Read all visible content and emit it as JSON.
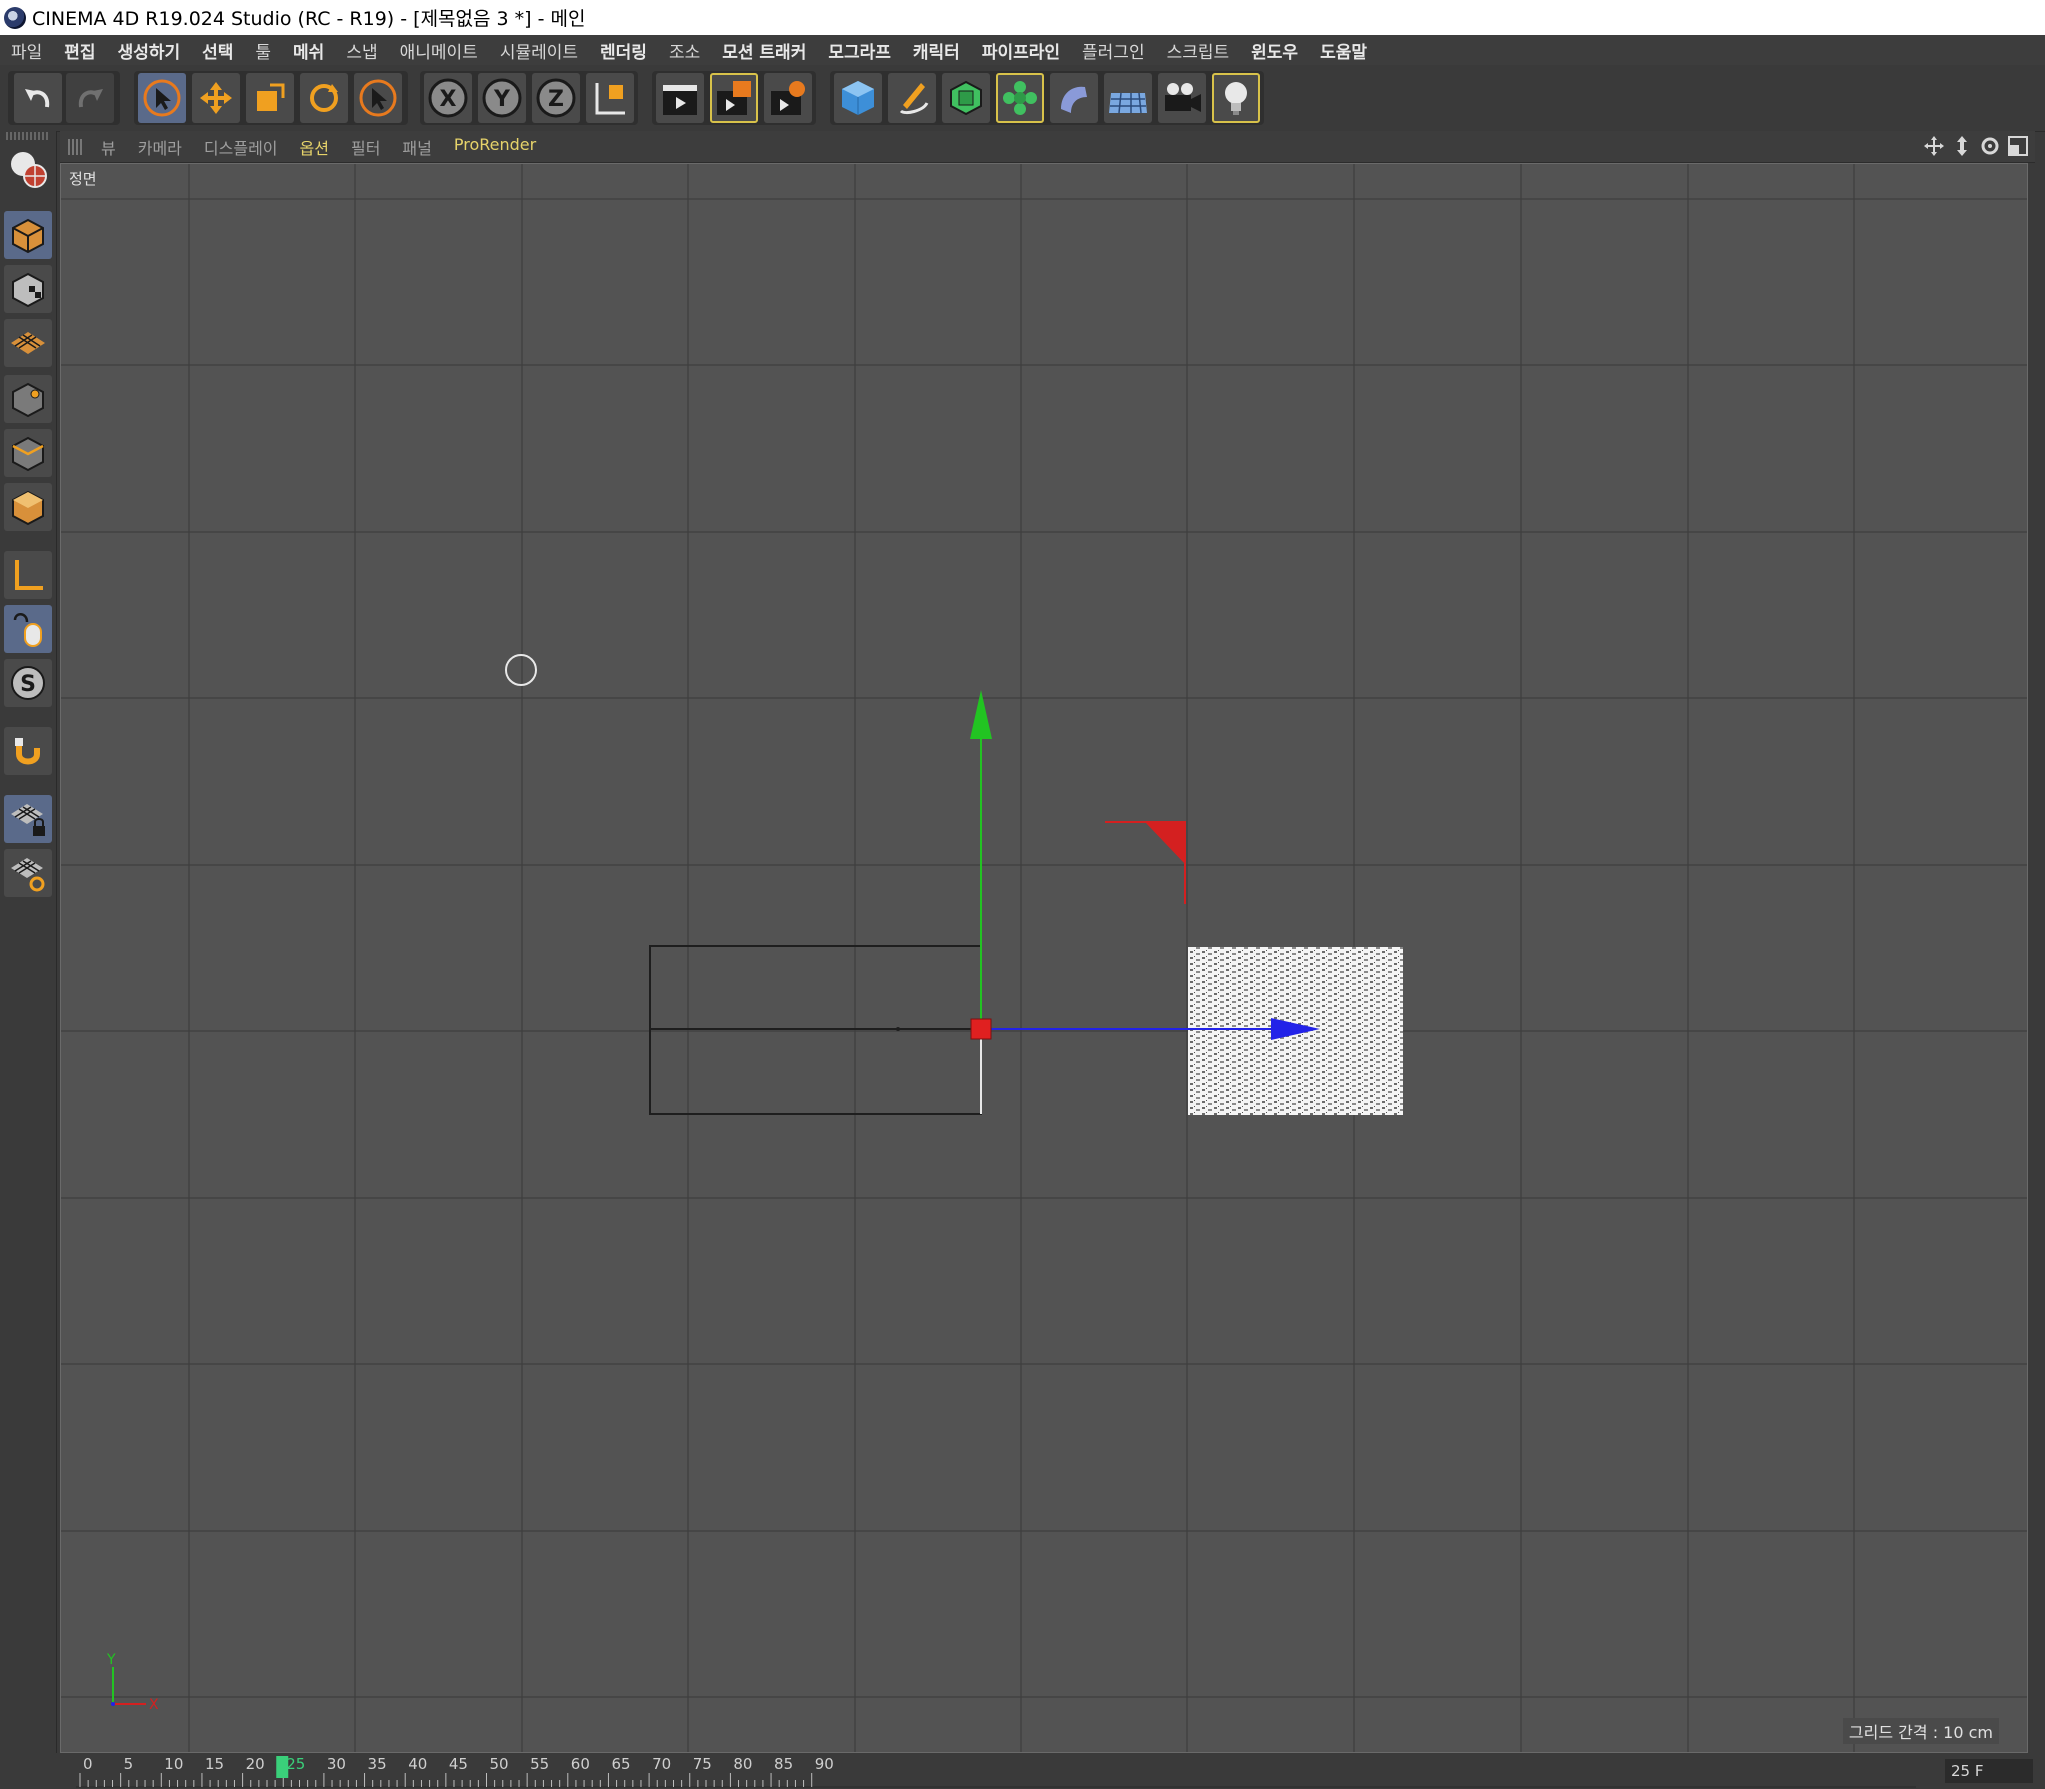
{
  "window": {
    "title": "CINEMA 4D R19.024 Studio (RC - R19) - [제목없음 3 *] - 메인"
  },
  "menu": [
    {
      "label": "파일",
      "bold": false
    },
    {
      "label": "편집",
      "bold": true
    },
    {
      "label": "생성하기",
      "bold": true
    },
    {
      "label": "선택",
      "bold": true
    },
    {
      "label": "툴",
      "bold": false
    },
    {
      "label": "메쉬",
      "bold": true
    },
    {
      "label": "스냅",
      "bold": false
    },
    {
      "label": "애니메이트",
      "bold": false
    },
    {
      "label": "시뮬레이트",
      "bold": false
    },
    {
      "label": "렌더링",
      "bold": true
    },
    {
      "label": "조소",
      "bold": false
    },
    {
      "label": "모션 트래커",
      "bold": true
    },
    {
      "label": "모그라프",
      "bold": true
    },
    {
      "label": "캐릭터",
      "bold": true
    },
    {
      "label": "파이프라인",
      "bold": true
    },
    {
      "label": "플러그인",
      "bold": false
    },
    {
      "label": "스크립트",
      "bold": false
    },
    {
      "label": "윈도우",
      "bold": true
    },
    {
      "label": "도움말",
      "bold": true
    }
  ],
  "toolbar": {
    "axis_x": "X",
    "axis_y": "Y",
    "axis_z": "Z"
  },
  "sidebar": {
    "snap_label": "S"
  },
  "view_menu": [
    {
      "label": "뷰",
      "state": "normal"
    },
    {
      "label": "카메라",
      "state": "normal"
    },
    {
      "label": "디스플레이",
      "state": "normal"
    },
    {
      "label": "옵션",
      "state": "active"
    },
    {
      "label": "필터",
      "state": "normal"
    },
    {
      "label": "패널",
      "state": "normal"
    },
    {
      "label": "ProRender",
      "state": "pr"
    }
  ],
  "viewport": {
    "name": "정면",
    "grid_spacing": "그리드 간격 : 10 cm",
    "axis_y_label": "Y",
    "axis_x_label": "X"
  },
  "timeline": {
    "ticks": [
      "0",
      "5",
      "10",
      "15",
      "20",
      "25",
      "30",
      "35",
      "40",
      "45",
      "50",
      "55",
      "60",
      "65",
      "70",
      "75",
      "80",
      "85",
      "90"
    ],
    "current_frame": 25,
    "end_field": "25 F"
  },
  "colors": {
    "y_axis": "#22c422",
    "x_axis": "#2222e8",
    "light_red": "#d42020",
    "accent": "#e6d36a"
  }
}
